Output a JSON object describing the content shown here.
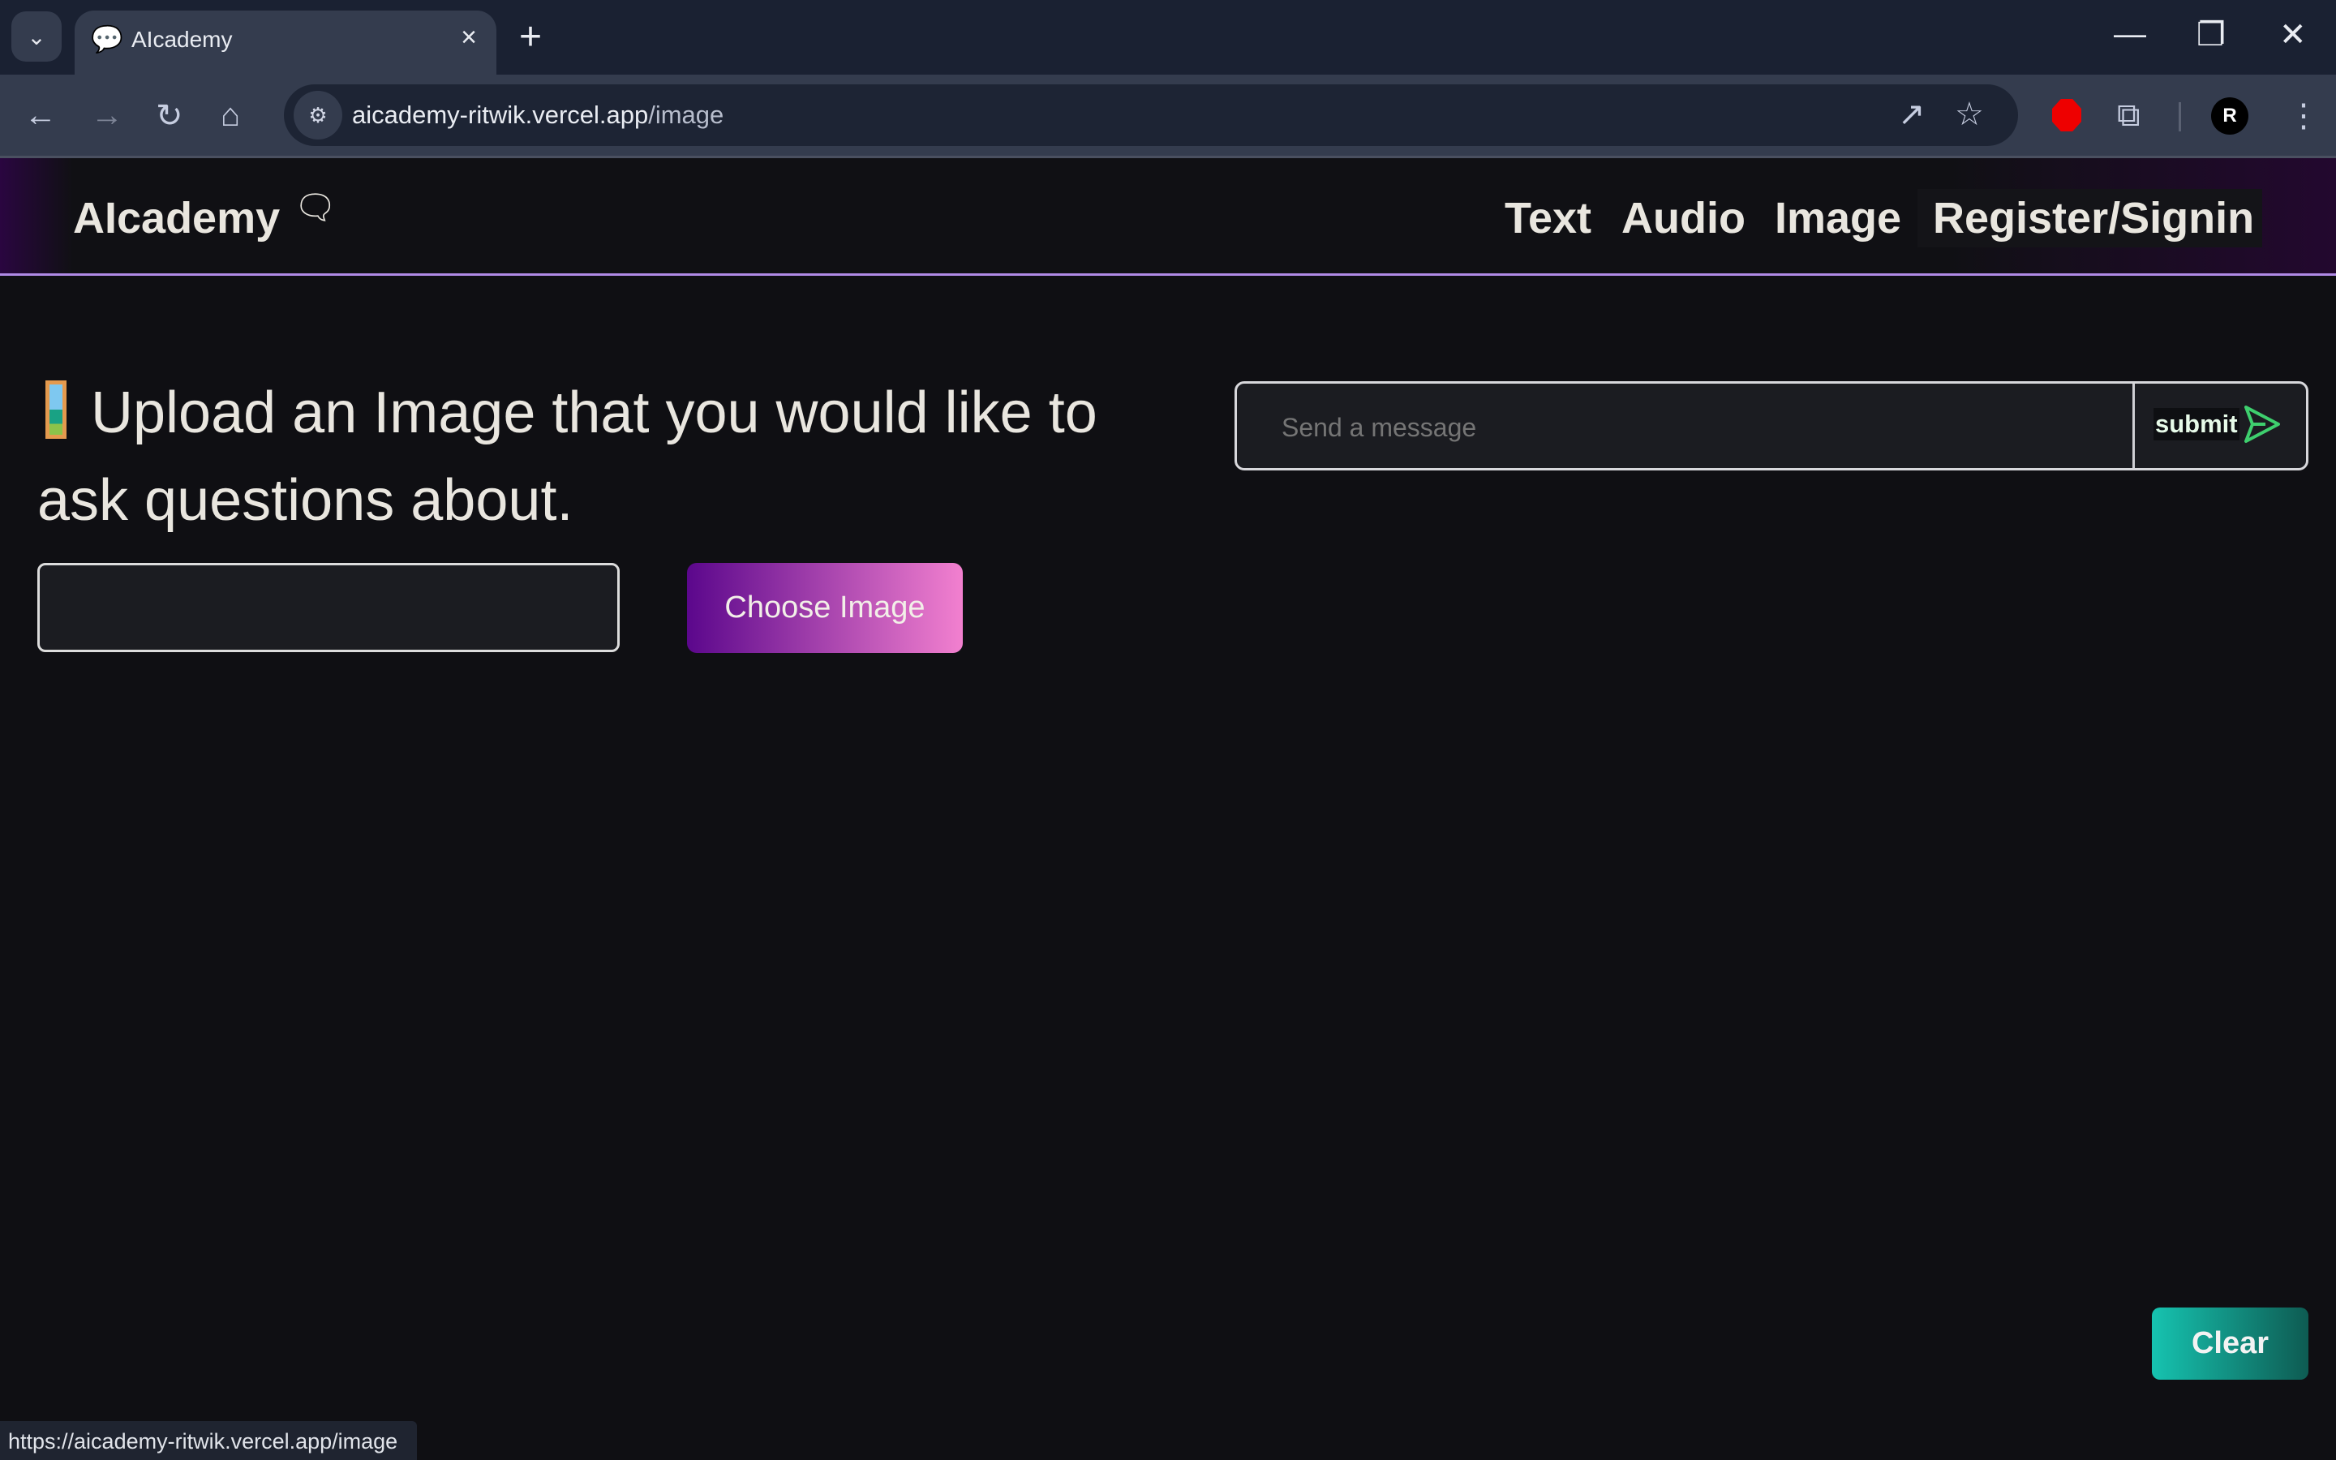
{
  "browser": {
    "tab_title": "AIcademy",
    "url_host": "aicademy-ritwik.vercel.app",
    "url_path": "/image",
    "status_url": "https://aicademy-ritwik.vercel.app/image",
    "profile_initial": "R"
  },
  "header": {
    "brand": "AIcademy",
    "nav": [
      "Text",
      "Audio",
      "Image",
      "Register/Signin"
    ]
  },
  "main": {
    "heading": "Upload an Image that you would like to ask questions about.",
    "choose_label": "Choose Image",
    "message_placeholder": "Send a message",
    "submit_label": "submit",
    "clear_label": "Clear"
  },
  "colors": {
    "accent_purple": "#5b078c",
    "accent_pink": "#f280cf",
    "clear_teal": "#16c3b0",
    "send_green": "#3ecf6e"
  }
}
